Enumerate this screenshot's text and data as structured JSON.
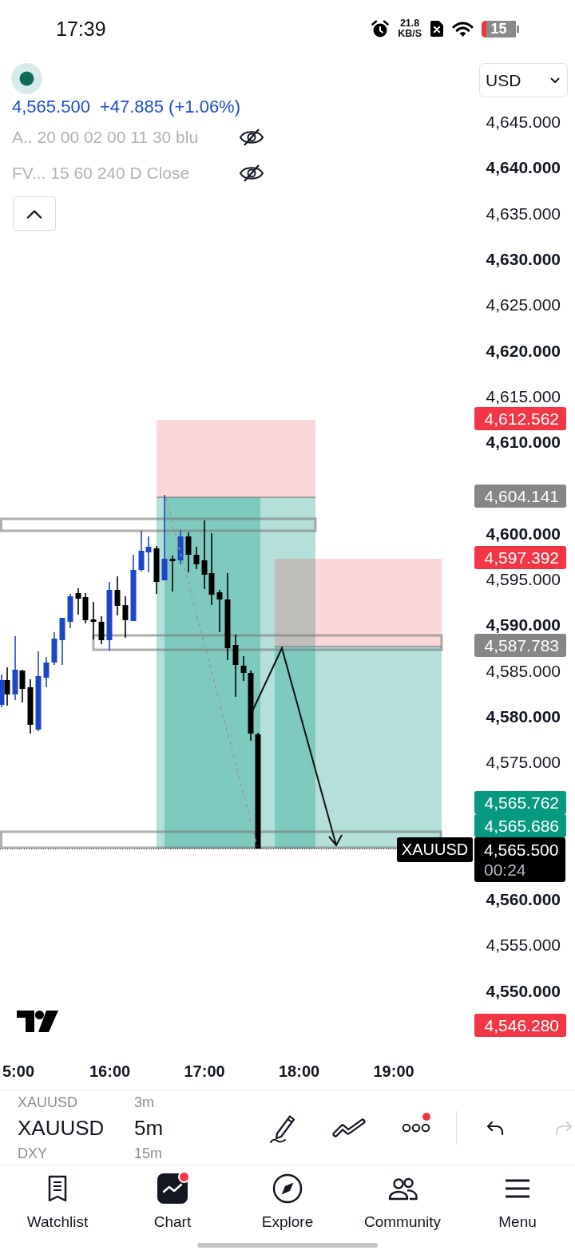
{
  "status_bar": {
    "time": "17:39",
    "net_speed": {
      "value": "21.8",
      "unit": "KB/S"
    },
    "battery": "15"
  },
  "header": {
    "price": "4,565.500",
    "change": "+47.885 (+1.06%)",
    "currency": "USD",
    "indicators": [
      {
        "label": "A.. 20 00 02 00 11 30 blu",
        "hidden": true
      },
      {
        "label": "FV... 15 60 240 D Close",
        "hidden": true
      }
    ]
  },
  "chart": {
    "price_axis": [
      {
        "label": "4,645.000",
        "major": false
      },
      {
        "label": "4,640.000",
        "major": true
      },
      {
        "label": "4,635.000",
        "major": false
      },
      {
        "label": "4,630.000",
        "major": true
      },
      {
        "label": "4,625.000",
        "major": false
      },
      {
        "label": "4,620.000",
        "major": true
      },
      {
        "label": "4,615.000",
        "major": false
      },
      {
        "label": "4,610.000",
        "major": true
      },
      {
        "label": "4,600.000",
        "major": true
      },
      {
        "label": "4,595.000",
        "major": false
      },
      {
        "label": "4,590.000",
        "major": true
      },
      {
        "label": "4,585.000",
        "major": false
      },
      {
        "label": "4,580.000",
        "major": true
      },
      {
        "label": "4,575.000",
        "major": false
      },
      {
        "label": "4,560.000",
        "major": true
      },
      {
        "label": "4,555.000",
        "major": false
      },
      {
        "label": "4,550.000",
        "major": true
      }
    ],
    "price_labels": [
      {
        "text": "4,612.562",
        "color": "#f23645"
      },
      {
        "text": "4,604.141",
        "color": "#868686"
      },
      {
        "text": "4,597.392",
        "color": "#f23645"
      },
      {
        "text": "4,587.783",
        "color": "#868686"
      },
      {
        "text": "4,565.762",
        "color": "#089981"
      },
      {
        "text": "4,565.686",
        "color": "#089981"
      },
      {
        "text": "4,546.280",
        "color": "#f23645"
      }
    ],
    "last_price": {
      "symbol": "XAUUSD",
      "price": "4,565.500",
      "countdown": "00:24"
    },
    "time_axis": [
      "5:00",
      "16:00",
      "17:00",
      "18:00",
      "19:00"
    ]
  },
  "symbol_picker": [
    {
      "symbol": "XAUUSD",
      "interval": "3m",
      "selected": false
    },
    {
      "symbol": "XAUUSD",
      "interval": "5m",
      "selected": true
    },
    {
      "symbol": "DXY",
      "interval": "15m",
      "selected": false
    }
  ],
  "toolbar": {
    "more": {
      "notification": true
    },
    "undo": {
      "disabled": false
    },
    "redo": {
      "disabled": true
    }
  },
  "bottom_nav": [
    {
      "label": "Watchlist",
      "selected": false,
      "notification": false
    },
    {
      "label": "Chart",
      "selected": true,
      "notification": true
    },
    {
      "label": "Explore",
      "selected": false,
      "notification": false
    },
    {
      "label": "Community",
      "selected": false,
      "notification": false
    },
    {
      "label": "Menu",
      "selected": false,
      "notification": false
    }
  ]
}
